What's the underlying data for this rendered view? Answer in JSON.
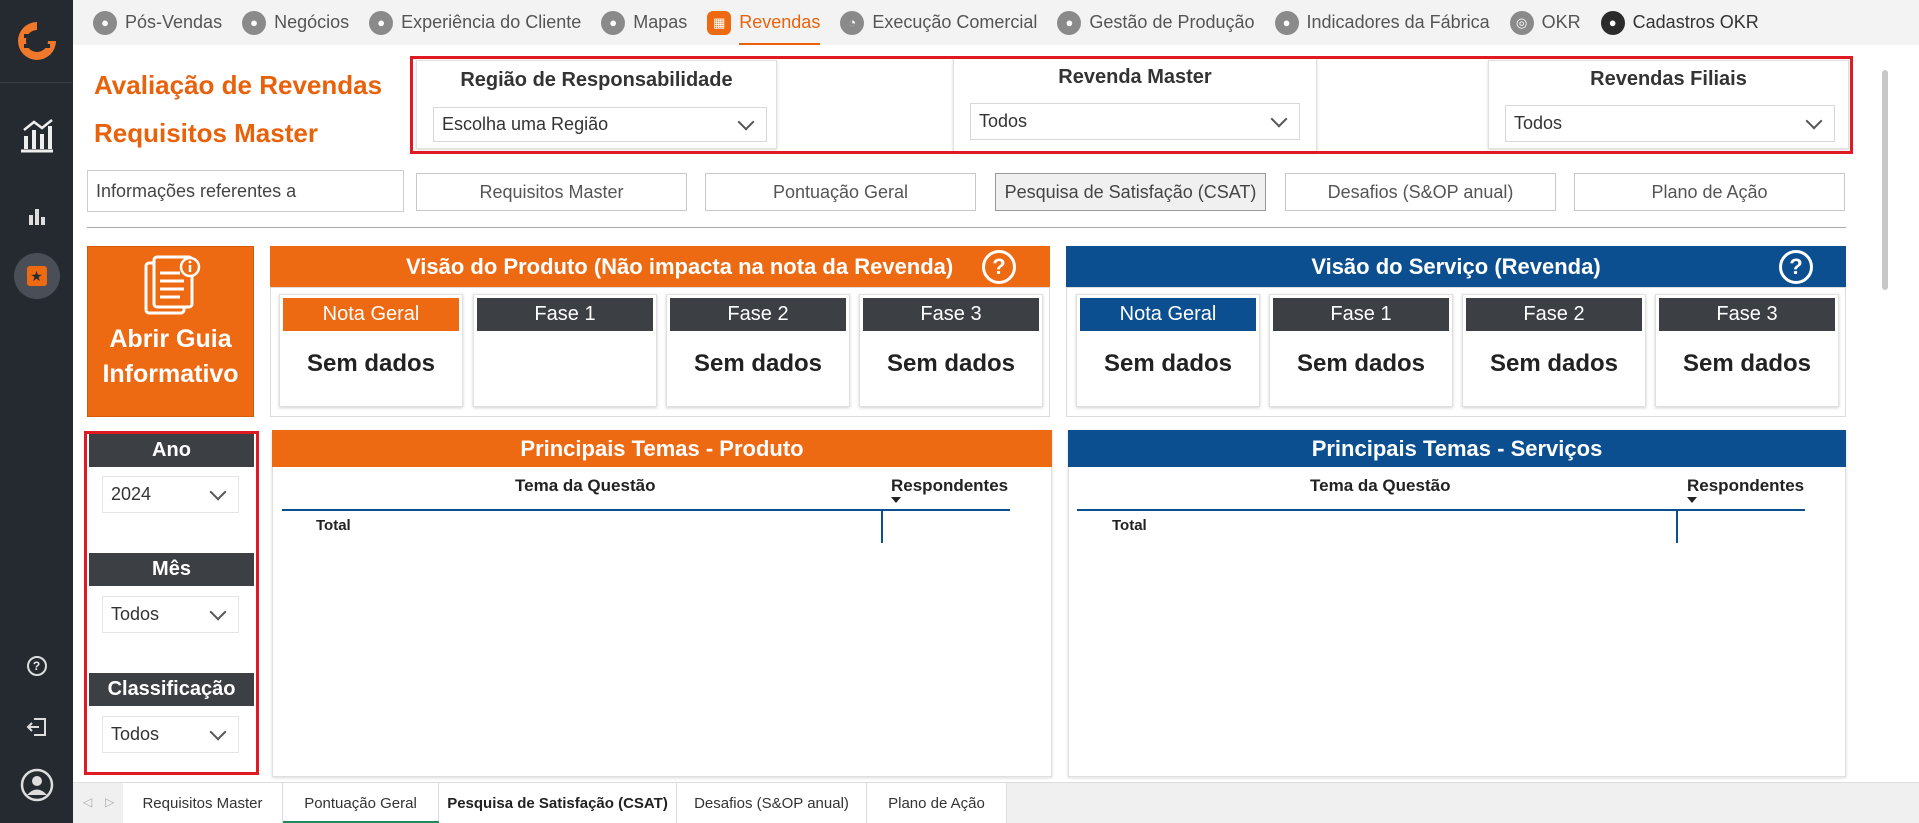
{
  "nav": {
    "items": [
      {
        "label": "Pós-Vendas",
        "icon": "person-icon"
      },
      {
        "label": "Negócios",
        "icon": "handshake-icon"
      },
      {
        "label": "Experiência do Cliente",
        "icon": "user-badge-icon"
      },
      {
        "label": "Mapas",
        "icon": "map-icon"
      },
      {
        "label": "Revendas",
        "icon": "store-icon",
        "active": true
      },
      {
        "label": "Execução Comercial",
        "icon": "clock-icon"
      },
      {
        "label": "Gestão de Produção",
        "icon": "factory-icon"
      },
      {
        "label": "Indicadores da Fábrica",
        "icon": "building-icon"
      },
      {
        "label": "OKR",
        "icon": "target-icon"
      },
      {
        "label": "Cadastros OKR",
        "icon": "account-icon",
        "dark": true
      }
    ]
  },
  "page": {
    "title_line1": "Avaliação de Revendas",
    "title_line2": "Requisitos Master"
  },
  "filters": {
    "regiao": {
      "label": "Região de Responsabilidade",
      "value": "Escolha uma Região"
    },
    "master": {
      "label": "Revenda Master",
      "value": "Todos"
    },
    "filiais": {
      "label": "Revendas Filiais",
      "value": "Todos"
    }
  },
  "info_label": "Informações referentes a",
  "tabs": [
    "Requisitos Master",
    "Pontuação Geral",
    "Pesquisa de Satisfação (CSAT)",
    "Desafios (S&OP anual)",
    "Plano de Ação"
  ],
  "guide": {
    "line1": "Abrir Guia",
    "line2": "Informativo"
  },
  "produto": {
    "title": "Visão do Produto (Não impacta na nota da Revenda)",
    "help": "?",
    "kpis": [
      {
        "label": "Nota Geral",
        "value": "Sem dados"
      },
      {
        "label": "Fase 1",
        "value": ""
      },
      {
        "label": "Fase 2",
        "value": "Sem dados"
      },
      {
        "label": "Fase 3",
        "value": "Sem dados"
      }
    ]
  },
  "servico": {
    "title": "Visão do Serviço (Revenda)",
    "help": "?",
    "kpis": [
      {
        "label": "Nota Geral",
        "value": "Sem dados"
      },
      {
        "label": "Fase 1",
        "value": "Sem dados"
      },
      {
        "label": "Fase 2",
        "value": "Sem dados"
      },
      {
        "label": "Fase 3",
        "value": "Sem dados"
      }
    ]
  },
  "side_filters": {
    "ano": {
      "label": "Ano",
      "value": "2024"
    },
    "mes": {
      "label": "Mês",
      "value": "Todos"
    },
    "classificacao": {
      "label": "Classificação",
      "value": "Todos"
    }
  },
  "temas_produto": {
    "title": "Principais Temas - Produto",
    "col1": "Tema da Questão",
    "col2": "Respondentes",
    "total": "Total"
  },
  "temas_servicos": {
    "title": "Principais Temas - Serviços",
    "col1": "Tema da Questão",
    "col2": "Respondentes",
    "total": "Total"
  },
  "bottom_tabs": [
    "Requisitos Master",
    "Pontuação Geral",
    "Pesquisa de Satisfação (CSAT)",
    "Desafios (S&OP anual)",
    "Plano de Ação"
  ],
  "colors": {
    "orange": "#e8620c",
    "blue": "#0b4f91",
    "dark": "#3c3f44",
    "red": "#e01a22"
  }
}
